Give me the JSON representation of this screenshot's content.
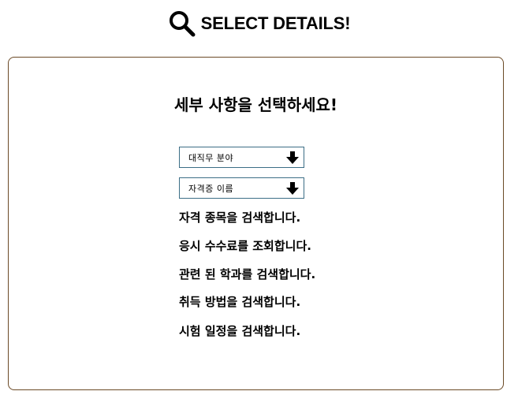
{
  "header": {
    "title": "SELECT DETAILS!",
    "icon": "search-icon"
  },
  "card": {
    "title": "세부 사항을 선택하세요!",
    "selects": {
      "field": {
        "label": "대직무 분야",
        "icon": "arrow-down-icon"
      },
      "cert": {
        "label": "자격증 이름",
        "icon": "arrow-down-icon"
      }
    },
    "actions": [
      {
        "label": "자격 종목을 검색합니다."
      },
      {
        "label": "응시 수수료를 조회합니다."
      },
      {
        "label": "관련 된 학과를 검색합니다."
      },
      {
        "label": "취득 방법을 검색합니다."
      },
      {
        "label": "시험 일정을 검색합니다."
      }
    ]
  },
  "colors": {
    "card_border": "#6b4a26",
    "select_border": "#3c6e86",
    "text": "#000000"
  }
}
